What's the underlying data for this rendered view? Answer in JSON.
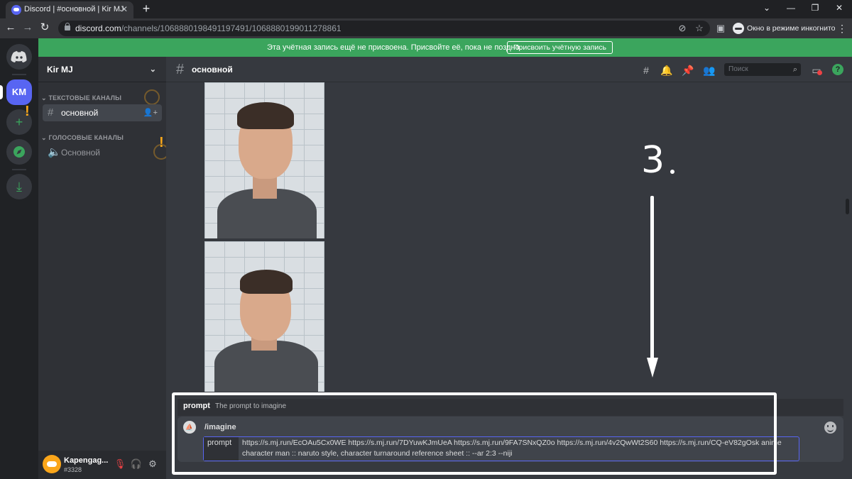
{
  "browser": {
    "tab_title": "Discord | #основной | Kir MJ",
    "url_host": "discord.com",
    "url_path": "/channels/1068880198491197491/1068880199011278861",
    "incognito_label": "Окно в режиме инкогнито"
  },
  "banner": {
    "text": "Эта учётная запись ещё не присвоена. Присвойте её, пока не поздно.",
    "button": "Присвоить учётную запись"
  },
  "servers": {
    "active_initials": "KM"
  },
  "guild": {
    "name": "Kir MJ",
    "text_category": "ТЕКСТОВЫЕ КАНАЛЫ",
    "text_channel": "основной",
    "voice_category": "ГОЛОСОВЫЕ КАНАЛЫ",
    "voice_channel": "Основной"
  },
  "user": {
    "name": "Kapengag...",
    "tag": "#3328"
  },
  "channel_header": {
    "title": "основной",
    "search_placeholder": "Поиск"
  },
  "command": {
    "option_name": "prompt",
    "option_description": "The prompt to imagine",
    "command_name": "/imagine",
    "field_label": "prompt",
    "field_value": "https://s.mj.run/EcOAu5Cx0WE https://s.mj.run/7DYuwKJmUeA https://s.mj.run/9FA7SNxQZ0o https://s.mj.run/4v2QwWt2S60 https://s.mj.run/CQ-eV82gOsk anime character man :: naruto style, character turnaround reference sheet :: --ar 2:3 --niji"
  },
  "annotation": {
    "step": "3"
  },
  "colors": {
    "blurple": "#5865f2",
    "green": "#3ba55d",
    "warning": "#faa81a",
    "bg_main": "#36393f",
    "bg_sidebar": "#2f3136"
  }
}
